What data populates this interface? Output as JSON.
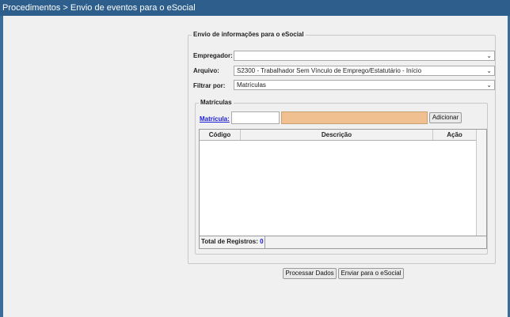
{
  "header": {
    "title": "Procedimentos > Envio de eventos para o eSocial"
  },
  "form": {
    "legend": "Envio de informações para o eSocial",
    "empregador": {
      "label": "Empregador:",
      "value": ""
    },
    "arquivo": {
      "label": "Arquivo:",
      "value": "S2300 - Trabalhador Sem Vínculo de Emprego/Estatutário - Início"
    },
    "filtrar": {
      "label": "Filtrar por:",
      "value": "Matrículas"
    }
  },
  "matriculas": {
    "legend": "Matrículas",
    "link_label": "Matrícula:",
    "input_value": "",
    "add_button": "Adicionar",
    "table": {
      "columns": [
        "Código",
        "Descrição",
        "Ação"
      ],
      "rows": [],
      "total_label": "Total de Registros:",
      "total_value": "0"
    }
  },
  "actions": {
    "process": "Processar Dados",
    "send": "Enviar para o eSocial"
  },
  "icons": {
    "dropdown": "chevron-down-icon"
  },
  "colors": {
    "header_bg": "#2e5f8c",
    "search_box": "#f0c090",
    "link": "#1a1ad8"
  }
}
